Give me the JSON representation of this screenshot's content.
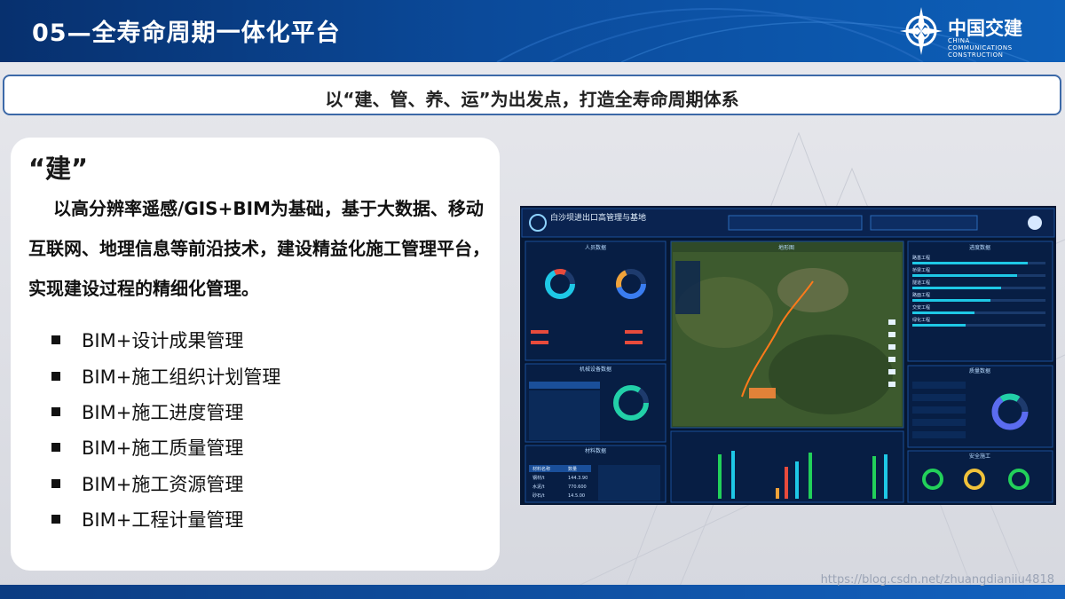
{
  "header": {
    "title": "05—全寿命周期一体化平台",
    "logo_text": "中国交建",
    "logo_subtitle": "CHINA COMMUNICATIONS CONSTRUCTION"
  },
  "subtitle_bar": "以“建、管、养、运”为出发点，打造全寿命周期体系",
  "section": {
    "heading": "“建”",
    "paragraph": "以高分辨率遥感/GIS+BIM为基础，基于大数据、移动互联网、地理信息等前沿技术，建设精益化施工管理平台，实现建设过程的精细化管理。",
    "items": [
      "BIM+设计成果管理",
      "BIM+施工组织计划管理",
      "BIM+施工进度管理",
      "BIM+施工质量管理",
      "BIM+施工资源管理",
      "BIM+工程计量管理"
    ]
  },
  "dashboard": {
    "title": "白沙坝进出口高管理与基地",
    "panels": {
      "left_top": "人员数据",
      "left_mid": "机械设备数据",
      "left_bottom": "材料数据",
      "center_top": "地形图",
      "right_top": "进度数据",
      "right_mid": "质量数据",
      "right_bottom": "安全施工"
    },
    "table_headers": [
      "材料名称",
      "数量"
    ],
    "table_rows": [
      [
        "钢材/t",
        "144.3.90"
      ],
      [
        "水泥/t",
        "770.600"
      ],
      [
        "砂石/t",
        "14.5.00"
      ]
    ],
    "progress_rows": [
      "路基工程",
      "桥梁工程",
      "隧道工程",
      "路面工程",
      "交安工程",
      "绿化工程"
    ],
    "watermark": "https://blog.csdn.net/zhuangdianiiu4818"
  },
  "colors": {
    "header_dark": "#07306e",
    "header_light": "#0d5fb8",
    "accent": "#3c69a8",
    "dash_bg": "#061733",
    "cyan": "#1ec8e6"
  }
}
